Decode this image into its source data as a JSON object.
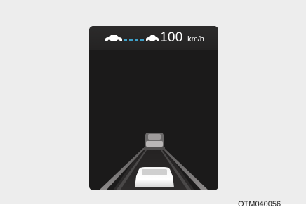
{
  "cluster": {
    "set_speed_value": "100",
    "set_speed_unit": "km/h",
    "icons": {
      "lead_vehicle": "car-side-icon",
      "following_distance": "distance-bars-icon",
      "own_vehicle": "car-side-icon"
    },
    "colors": {
      "background": "#1b1a1a",
      "distance_bars": "#3fa0c8",
      "text": "#ffffff"
    }
  },
  "caption": "OTM040056"
}
